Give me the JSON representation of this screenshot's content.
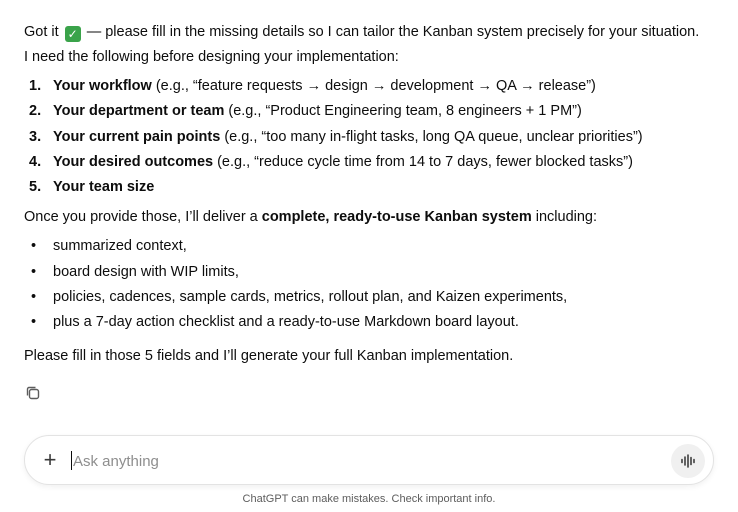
{
  "message": {
    "intro": {
      "before_icon": "Got it ",
      "icon": "check-mark-button-icon",
      "after_icon": " — please fill in the missing details so I can tailor the Kanban system precisely for your situation."
    },
    "need_line": "I need the following before designing your implementation:",
    "steps": [
      {
        "num": "1.",
        "label": "Your workflow",
        "example": " (e.g., “feature requests → design → development → QA → release”)"
      },
      {
        "num": "2.",
        "label": "Your department or team",
        "example": " (e.g., “Product Engineering team, 8 engineers + 1 PM”)"
      },
      {
        "num": "3.",
        "label": "Your current pain points",
        "example": " (e.g., “too many in-flight tasks, long QA queue, unclear priorities”)"
      },
      {
        "num": "4.",
        "label": "Your desired outcomes",
        "example": " (e.g., “reduce cycle time from 14 to 7 days, fewer blocked tasks”)"
      },
      {
        "num": "5.",
        "label": "Your team size",
        "example": ""
      }
    ],
    "deliver": {
      "before": "Once you provide those, I’ll deliver a ",
      "bold": "complete, ready-to-use Kanban system",
      "after": " including:"
    },
    "bullets": [
      {
        "bullet": "•",
        "text": "summarized context,"
      },
      {
        "bullet": "•",
        "text": "board design with WIP limits,"
      },
      {
        "bullet": "•",
        "text": "policies, cadences, sample cards, metrics, rollout plan, and Kaizen experiments,"
      },
      {
        "bullet": "•",
        "text": "plus a 7-day action checklist and a ready-to-use Markdown board layout."
      }
    ],
    "closing": "Please fill in those 5 fields and I’ll generate your full Kanban implementation."
  },
  "actions": {
    "copy_icon": "copy-icon"
  },
  "composer": {
    "plus_label": "+",
    "placeholder": "Ask anything",
    "value": "",
    "voice_icon": "voice-waveform-icon"
  },
  "footer": {
    "disclaimer": "ChatGPT can make mistakes. Check important info."
  },
  "colors": {
    "check_bg": "#3aa34a",
    "text": "#0d0d0d",
    "muted": "#5d5d5d"
  }
}
